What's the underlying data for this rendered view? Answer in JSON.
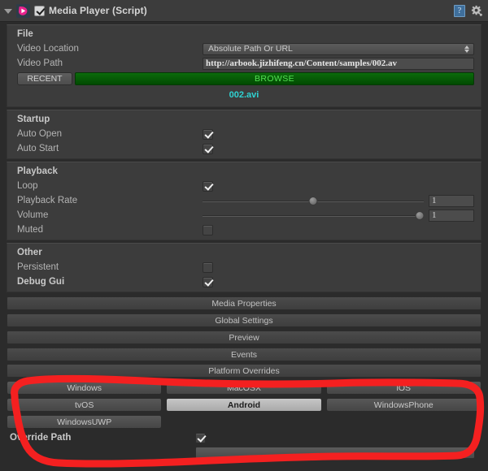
{
  "header": {
    "title": "Media Player (Script)",
    "enabled_checkbox": true,
    "icon": "media-player-script-icon",
    "help_icon": "help-book-icon",
    "help_glyph": "?",
    "settings_icon": "gear-icon",
    "foldout_icon": "foldout-expanded-icon"
  },
  "file": {
    "group_title": "File",
    "video_location": {
      "label": "Video Location",
      "value": "Absolute Path Or URL"
    },
    "video_path": {
      "label": "Video Path",
      "value": "http://arbook.jizhifeng.cn/Content/samples/002.av"
    },
    "recent_button": "RECENT",
    "browse_button": "BROWSE",
    "browse_color": "#53e053",
    "filename": "002.avi",
    "filename_color": "#2fd3d3"
  },
  "startup": {
    "group_title": "Startup",
    "rows": [
      {
        "label": "Auto Open",
        "checked": true
      },
      {
        "label": "Auto Start",
        "checked": true
      }
    ]
  },
  "playback": {
    "group_title": "Playback",
    "loop": {
      "label": "Loop",
      "checked": true
    },
    "playback_rate": {
      "label": "Playback Rate",
      "value": "1",
      "slider_percent": 50
    },
    "volume": {
      "label": "Volume",
      "value": "1",
      "slider_percent": 98
    },
    "muted": {
      "label": "Muted",
      "checked": false
    }
  },
  "other": {
    "group_title": "Other",
    "persistent": {
      "label": "Persistent",
      "checked": false
    },
    "debug_gui": {
      "label": "Debug Gui",
      "checked": true,
      "bold": true
    }
  },
  "sections": [
    {
      "label": "Media Properties"
    },
    {
      "label": "Global Settings"
    },
    {
      "label": "Preview"
    },
    {
      "label": "Events"
    }
  ],
  "platform_overrides": {
    "title": "Platform Overrides",
    "buttons": [
      {
        "label": "Windows",
        "active": false
      },
      {
        "label": "MacOSX",
        "active": false
      },
      {
        "label": "iOS",
        "active": false
      },
      {
        "label": "tvOS",
        "active": false
      },
      {
        "label": "Android",
        "active": true
      },
      {
        "label": "WindowsPhone",
        "active": false
      },
      {
        "label": "WindowsUWP",
        "active": false
      }
    ]
  },
  "tail": {
    "override_path": {
      "label": "Override Path",
      "checked": true
    }
  },
  "annotation": {
    "type": "hand-drawn-red-circle",
    "color": "#f42020",
    "stroke_width": 8
  }
}
